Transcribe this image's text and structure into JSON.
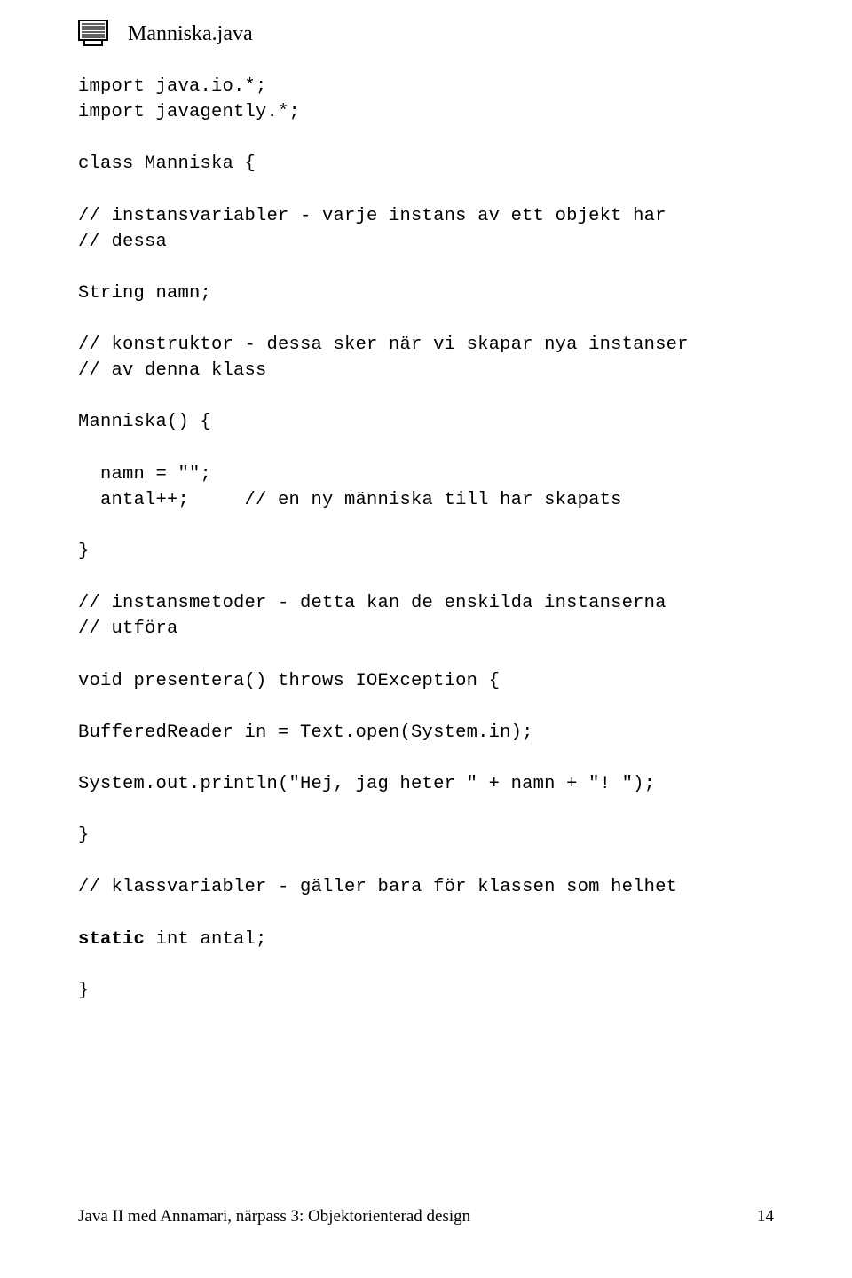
{
  "heading": "Manniska.java",
  "code": {
    "l1": "import java.io.*;",
    "l2": "import javagently.*;",
    "l3": "class Manniska {",
    "l4": "// instansvariabler - varje instans av ett objekt har",
    "l5": "// dessa",
    "l6": "String namn;",
    "l7": "// konstruktor - dessa sker när vi skapar nya instanser",
    "l8": "// av denna klass",
    "l9": "Manniska() {",
    "l10": "  namn = \"\";",
    "l11": "  antal++;     // en ny människa till har skapats",
    "l12": "}",
    "l13": "// instansmetoder - detta kan de enskilda instanserna",
    "l14": "// utföra",
    "l15": "void presentera() throws IOException {",
    "l16": "BufferedReader in = Text.open(System.in);",
    "l17": "System.out.println(\"Hej, jag heter \" + namn + \"! \");",
    "l18": "}",
    "l19": "// klassvariabler - gäller bara för klassen som helhet",
    "l20a": "static",
    "l20b": " int antal;",
    "l21": "}"
  },
  "footer": {
    "left": "Java II med Annamari, närpass 3: Objektorienterad design",
    "right": "14"
  }
}
